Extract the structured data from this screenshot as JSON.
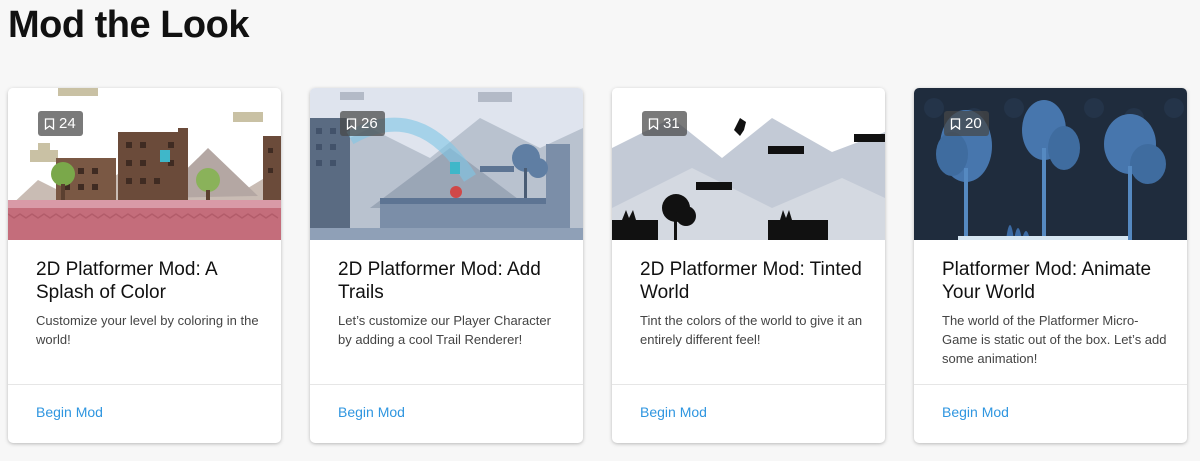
{
  "page": {
    "title": "Mod the Look"
  },
  "colors": {
    "link": "#2f96e0"
  },
  "cards": [
    {
      "bookmarks": "24",
      "title": "2D Platformer Mod: A Splash of Color",
      "description": "Customize your level by coloring in the world!",
      "link": "Begin Mod"
    },
    {
      "bookmarks": "26",
      "title": "2D Platformer Mod: Add Trails",
      "description": "Let’s customize our Player Character by adding a cool Trail Renderer!",
      "link": "Begin Mod"
    },
    {
      "bookmarks": "31",
      "title": "2D Platformer Mod: Tinted World",
      "description": "Tint the colors of the world to give it an entirely different feel!",
      "link": "Begin Mod"
    },
    {
      "bookmarks": "20",
      "title": "Platformer Mod: Animate Your World",
      "description": "The world of the Platformer Micro-Game is static out of the box. Let’s add some animation!",
      "link": "Begin Mod"
    }
  ]
}
